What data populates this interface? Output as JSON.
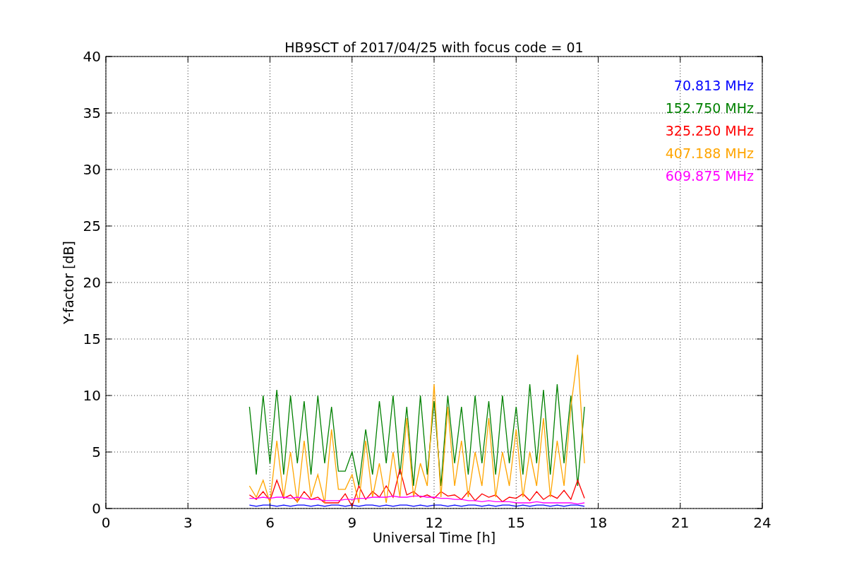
{
  "figure": {
    "chart_data": {
      "type": "line",
      "title": "HB9SCT of 2017/04/25 with focus code = 01",
      "xlabel": "Universal Time [h]",
      "ylabel": "Y-factor [dB]",
      "x": [
        5.25,
        5.5,
        5.75,
        6,
        6.25,
        6.5,
        6.75,
        7,
        7.25,
        7.5,
        7.75,
        8,
        8.25,
        8.5,
        8.75,
        9,
        9.25,
        9.5,
        9.75,
        10,
        10.25,
        10.5,
        10.75,
        11,
        11.25,
        11.5,
        11.75,
        12,
        12.25,
        12.5,
        12.75,
        13,
        13.25,
        13.5,
        13.75,
        14,
        14.25,
        14.5,
        14.75,
        15,
        15.25,
        15.5,
        15.75,
        16,
        16.25,
        16.5,
        16.75,
        17,
        17.25,
        17.5
      ],
      "grid": true,
      "xlim": [
        0,
        24
      ],
      "ylim": [
        0,
        40
      ],
      "xticks": [
        0,
        3,
        6,
        9,
        12,
        15,
        18,
        21,
        24
      ],
      "yticks": [
        0,
        5,
        10,
        15,
        20,
        25,
        30,
        35,
        40
      ],
      "series": [
        {
          "name": "70.813 MHz",
          "color": "#0000ff",
          "values": [
            0.3,
            0.2,
            0.3,
            0.3,
            0.2,
            0.3,
            0.2,
            0.3,
            0.3,
            0.2,
            0.3,
            0.2,
            0.3,
            0.3,
            0.2,
            0.3,
            0.2,
            0.3,
            0.3,
            0.2,
            0.3,
            0.2,
            0.3,
            0.3,
            0.2,
            0.3,
            0.2,
            0.3,
            0.3,
            0.2,
            0.3,
            0.2,
            0.3,
            0.3,
            0.2,
            0.3,
            0.2,
            0.3,
            0.3,
            0.2,
            0.3,
            0.2,
            0.3,
            0.3,
            0.2,
            0.3,
            0.2,
            0.3,
            0.3,
            0.2
          ]
        },
        {
          "name": "152.750 MHz",
          "color": "#008000",
          "values": [
            9,
            3,
            10,
            4,
            10.5,
            3,
            10,
            4,
            9.5,
            3,
            10,
            4,
            9,
            3.3,
            3.3,
            5,
            2,
            7,
            3,
            9.5,
            4,
            10,
            3,
            9,
            2,
            10,
            3,
            9.5,
            2,
            10,
            4,
            9,
            3,
            10,
            4,
            9.5,
            3,
            10,
            4,
            9,
            3,
            11,
            4,
            10.5,
            3,
            11,
            4,
            10,
            2,
            9
          ]
        },
        {
          "name": "325.250 MHz",
          "color": "#ff0000",
          "values": [
            1.2,
            0.8,
            1.5,
            0.7,
            2.5,
            0.9,
            1.2,
            0.6,
            1.5,
            0.8,
            1.0,
            0.5,
            0.5,
            0.5,
            1.3,
            0.2,
            2,
            0.8,
            1.5,
            1,
            2,
            1,
            3.5,
            1.2,
            1.5,
            1,
            1.2,
            0.9,
            1.5,
            1.1,
            1.2,
            0.8,
            1.5,
            0.7,
            1.3,
            1,
            1.2,
            0.6,
            1,
            0.9,
            1.3,
            0.7,
            1.5,
            0.8,
            1.2,
            0.9,
            1.6,
            0.8,
            2.5,
            0.9
          ]
        },
        {
          "name": "407.188 MHz",
          "color": "#ffa500",
          "values": [
            2,
            1,
            2.5,
            0.5,
            6,
            1,
            5,
            0.5,
            6,
            1,
            3,
            0.5,
            7,
            1.7,
            1.7,
            3,
            0.5,
            6,
            1,
            4,
            0.5,
            5,
            1,
            8,
            1,
            4,
            2,
            11,
            1,
            9,
            2,
            6,
            1,
            5,
            2,
            8,
            1,
            5,
            2,
            7,
            1,
            5,
            2,
            8,
            1,
            6,
            2,
            9,
            13.6,
            4
          ]
        },
        {
          "name": "609.875 MHz",
          "color": "#ff00ff",
          "values": [
            0.9,
            0.9,
            1,
            0.9,
            1,
            1,
            0.9,
            1,
            0.9,
            0.8,
            0.8,
            0.7,
            0.7,
            0.7,
            0.8,
            0.8,
            0.9,
            0.9,
            1,
            1,
            1,
            1.1,
            1,
            1,
            1.1,
            1.1,
            1,
            1,
            0.9,
            0.9,
            0.8,
            0.8,
            0.7,
            0.7,
            0.6,
            0.7,
            0.6,
            0.6,
            0.6,
            0.5,
            0.5,
            0.5,
            0.6,
            0.5,
            0.5,
            0.5,
            0.5,
            0.5,
            0.4,
            0.5
          ]
        }
      ]
    }
  }
}
